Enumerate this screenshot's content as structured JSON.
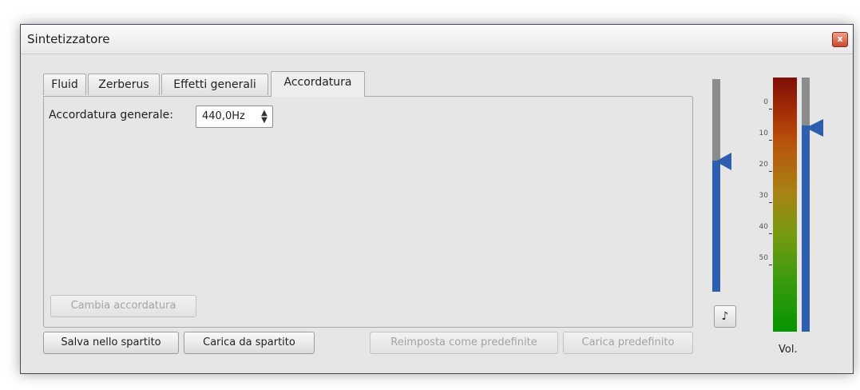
{
  "window": {
    "title": "Sintetizzatore",
    "close_glyph": "x"
  },
  "tabs": [
    {
      "label": "Fluid"
    },
    {
      "label": "Zerberus"
    },
    {
      "label": "Effetti generali"
    },
    {
      "label": "Accordatura"
    }
  ],
  "active_tab": "Accordatura",
  "tuning": {
    "label": "Accordatura generale:",
    "value": "440,0Hz",
    "change_button": "Cambia accordatura"
  },
  "buttons": {
    "save_to_score": "Salva nello spartito",
    "load_from_score": "Carica da spartito",
    "reset_default": "Reimposta come predefinite",
    "load_default": "Carica predefinito"
  },
  "master_slider": {
    "level_fraction": 0.62
  },
  "metronome_icon": "metronome-icon",
  "volume_meter": {
    "ticks": [
      "0",
      "10",
      "20",
      "30",
      "40",
      "50"
    ],
    "label": "Vol.",
    "level_fraction": 0.82
  },
  "colors": {
    "slider_blue": "#2e5faf",
    "window_bg": "#e6e6e6"
  }
}
